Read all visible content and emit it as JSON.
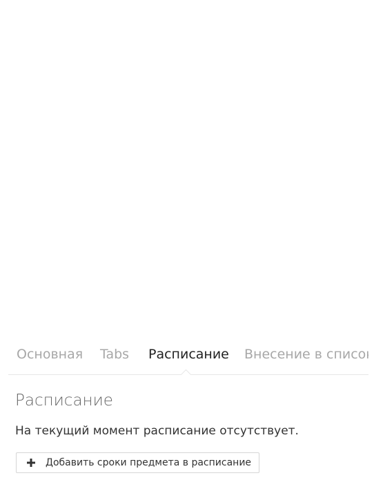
{
  "tabs": [
    {
      "label": "Основная",
      "active": false
    },
    {
      "label": "Tabs",
      "active": false
    },
    {
      "label": "Расписание",
      "active": true
    },
    {
      "label": "Внесение в список у",
      "active": false
    }
  ],
  "schedule": {
    "title": "Расписание",
    "empty_message": "На текущий момент расписание отсутствует.",
    "add_button_label": "Добавить сроки предмета в расписание",
    "add_button_icon": "plus-icon"
  }
}
